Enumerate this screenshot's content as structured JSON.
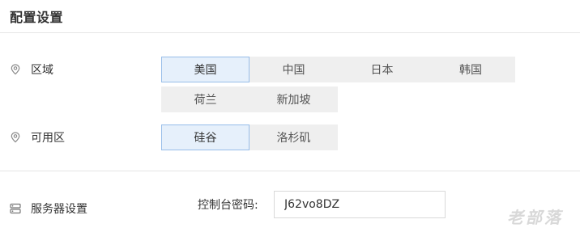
{
  "page": {
    "title": "配置设置"
  },
  "region": {
    "label": "区域",
    "icon": "location-pin-icon",
    "options": [
      "美国",
      "中国",
      "日本",
      "韩国",
      "荷兰",
      "新加坡"
    ],
    "selected": "美国"
  },
  "zone": {
    "label": "可用区",
    "icon": "location-pin-icon",
    "options": [
      "硅谷",
      "洛杉矶"
    ],
    "selected": "硅谷"
  },
  "server": {
    "label": "服务器设置",
    "icon": "server-icon",
    "console_password_label": "控制台密码:",
    "console_password_value": "J62vo8DZ"
  },
  "watermark": "老部落",
  "colors": {
    "selected_bg": "#e6f0fb",
    "selected_border": "#97bde9",
    "option_bg": "#efefef"
  }
}
